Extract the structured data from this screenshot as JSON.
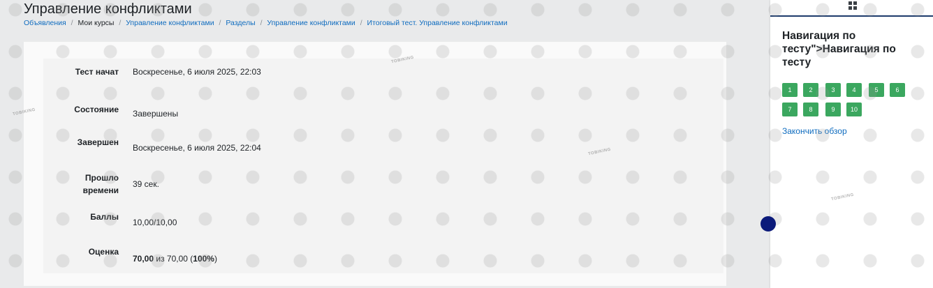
{
  "page": {
    "title": "Управление конфликтами"
  },
  "breadcrumb": {
    "items": [
      {
        "label": "Объявления",
        "link": true
      },
      {
        "label": "Мои курсы",
        "link": false
      },
      {
        "label": "Управление конфликтами",
        "link": true
      },
      {
        "label": "Разделы",
        "link": true
      },
      {
        "label": "Управление конфликтами",
        "link": true
      },
      {
        "label": "Итоговый тест. Управление конфликтами",
        "link": true
      }
    ],
    "separator": "/"
  },
  "summary": {
    "started_label": "Тест начат",
    "started_value": "Воскресенье, 6 июля 2025, 22:03",
    "state_label": "Состояние",
    "state_value": "Завершены",
    "completed_label": "Завершен",
    "completed_value": "Воскресенье, 6 июля 2025, 22:04",
    "time_label_1": "Прошло",
    "time_label_2": "времени",
    "time_value": "39 сек.",
    "marks_label": "Баллы",
    "marks_value": "10,00/10,00",
    "grade_label": "Оценка",
    "grade_score": "70,00",
    "grade_of": "из 70,00 (",
    "grade_percent": "100%",
    "grade_close": ")"
  },
  "drawer": {
    "icon": "grid-icon",
    "title": "Навигация по тесту\">Навигация по тесту",
    "questions": [
      "1",
      "2",
      "3",
      "4",
      "5",
      "6",
      "7",
      "8",
      "9",
      "10"
    ],
    "finish_review": "Закончить обзор"
  },
  "watermark": {
    "text": "TOBIKING"
  },
  "colors": {
    "accent": "#0f6cbf",
    "answered": "#3ba75f",
    "scroll_dot": "#0b1a7a"
  }
}
